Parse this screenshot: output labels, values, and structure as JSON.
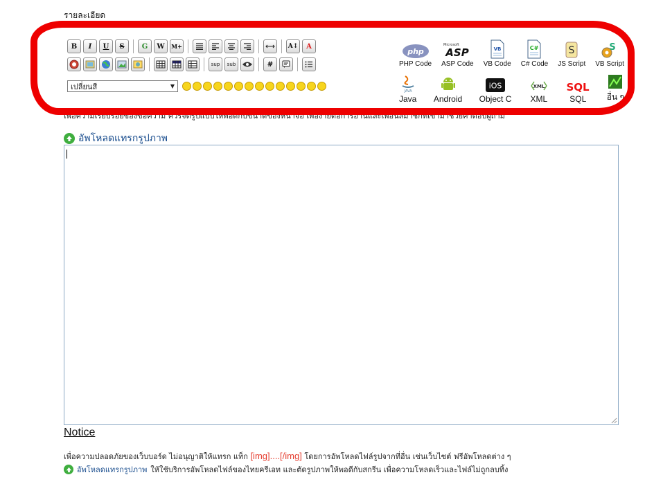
{
  "form": {
    "label": "รายละเอียด"
  },
  "toolbar": {
    "row1": [
      {
        "name": "bold-button",
        "text": "B"
      },
      {
        "name": "italic-button",
        "text": "I"
      },
      {
        "name": "underline-button",
        "text": "U"
      },
      {
        "name": "strike-button",
        "text": "S"
      },
      {
        "sep": true
      },
      {
        "name": "google-button",
        "text": "G"
      },
      {
        "name": "wikipedia-button",
        "text": "W"
      },
      {
        "name": "more-button",
        "text": "M+"
      },
      {
        "sep": true
      },
      {
        "name": "align-justify-button",
        "icon": "align-justify-icon"
      },
      {
        "name": "align-left-button",
        "icon": "align-left-icon"
      },
      {
        "name": "align-center-button",
        "icon": "align-center-icon"
      },
      {
        "name": "align-right-button",
        "icon": "align-right-icon"
      },
      {
        "sep": true
      },
      {
        "name": "horizontal-rule-button",
        "icon": "horizontal-rule-icon"
      },
      {
        "sep": true
      },
      {
        "name": "font-size-button",
        "text": "A↕"
      },
      {
        "name": "font-color-button",
        "text": "A"
      }
    ],
    "row2": [
      {
        "name": "insert-flash-button",
        "icon": "flash-icon"
      },
      {
        "name": "insert-video-button",
        "icon": "video-icon"
      },
      {
        "name": "insert-link-button",
        "icon": "globe-icon"
      },
      {
        "name": "insert-image-button",
        "icon": "image-icon"
      },
      {
        "name": "insert-photo-button",
        "icon": "photo-icon"
      },
      {
        "sep": true
      },
      {
        "name": "table-button",
        "icon": "table-icon"
      },
      {
        "name": "table-header-button",
        "icon": "table-header-icon"
      },
      {
        "name": "table-cell-button",
        "icon": "table-cell-icon"
      },
      {
        "sep": true
      },
      {
        "name": "superscript-button",
        "text": "sup"
      },
      {
        "name": "subscript-button",
        "text": "sub"
      },
      {
        "name": "spoiler-button",
        "icon": "eye-icon"
      },
      {
        "sep": true
      },
      {
        "name": "hash-button",
        "text": "#"
      },
      {
        "name": "quote-button",
        "icon": "quote-icon"
      },
      {
        "sep": true
      },
      {
        "name": "list-button",
        "icon": "list-icon"
      }
    ],
    "color_select": {
      "value": "เปลี่ยนสี"
    },
    "smiley_count": 14
  },
  "code_buttons": {
    "row1": [
      {
        "name": "php-code-button",
        "label": "PHP Code",
        "logo": "php-logo-icon",
        "logo_text": "php"
      },
      {
        "name": "asp-code-button",
        "label": "ASP Code",
        "logo": "asp-logo-icon",
        "logo_text": "ASP",
        "logo_sub": "Microsoft"
      },
      {
        "name": "vb-code-button",
        "label": "VB Code",
        "logo": "vb-doc-icon",
        "logo_text": "VB"
      },
      {
        "name": "csharp-code-button",
        "label": "C# Code",
        "logo": "csharp-doc-icon",
        "logo_text": "C#"
      },
      {
        "name": "js-script-button",
        "label": "JS Script",
        "logo": "js-scroll-icon",
        "logo_text": "S"
      },
      {
        "name": "vb-script-button",
        "label": "VB Script",
        "logo": "vbs-gear-icon",
        "logo_text": "S"
      }
    ],
    "row2": [
      {
        "name": "java-button",
        "label": "Java",
        "logo": "java-logo-icon",
        "logo_text": "JAVA"
      },
      {
        "name": "android-button",
        "label": "Android",
        "logo": "android-logo-icon",
        "logo_text": ""
      },
      {
        "name": "object-c-button",
        "label": "Object C",
        "logo": "ios-logo-icon",
        "logo_text": "iOS"
      },
      {
        "name": "xml-button",
        "label": "XML",
        "logo": "xml-logo-icon",
        "logo_text": "XML"
      },
      {
        "name": "sql-button",
        "label": "SQL",
        "logo": "sql-logo-icon",
        "logo_text": "SQL"
      },
      {
        "name": "other-button",
        "label": "อื่น ๆ",
        "logo": "other-green-icon",
        "logo_text": ""
      }
    ]
  },
  "hint": "เพื่อความเรียบร้อยของข้อความ ควรจัดรูปแบบให้พอดีกับขนาดของหน้าจอ เพื่อง่ายต่อการอ่านและเพื่อนสมาชิกที่เข้ามาช่วยคำตอบผู้ถาม",
  "upload": {
    "label": "อัพโหลดแทรกรูปภาพ"
  },
  "notice": {
    "title": "Notice",
    "line1_pre": "เพื่อความปลอดภัยของเว็บบอร์ด ไม่อนุญาติให้แทรก แท็ก",
    "line1_tag": "[img]....[/img]",
    "line1_post": "โดยการอัพโหลดไฟล์รูปจากที่อื่น เช่นเว็บไซต์ ฟรีอัพโหลดต่าง ๆ",
    "line2_link": "อัพโหลดแทรกรูปภาพ",
    "line2_post": "ให้ใช้บริการอัพโหลดไฟล์ของไทยครีเอท และตัดรูปภาพให้พอดีกับสกรีน เพื่อความโหลดเร็วและไฟล์ไม่ถูกลบทิ้ง"
  }
}
